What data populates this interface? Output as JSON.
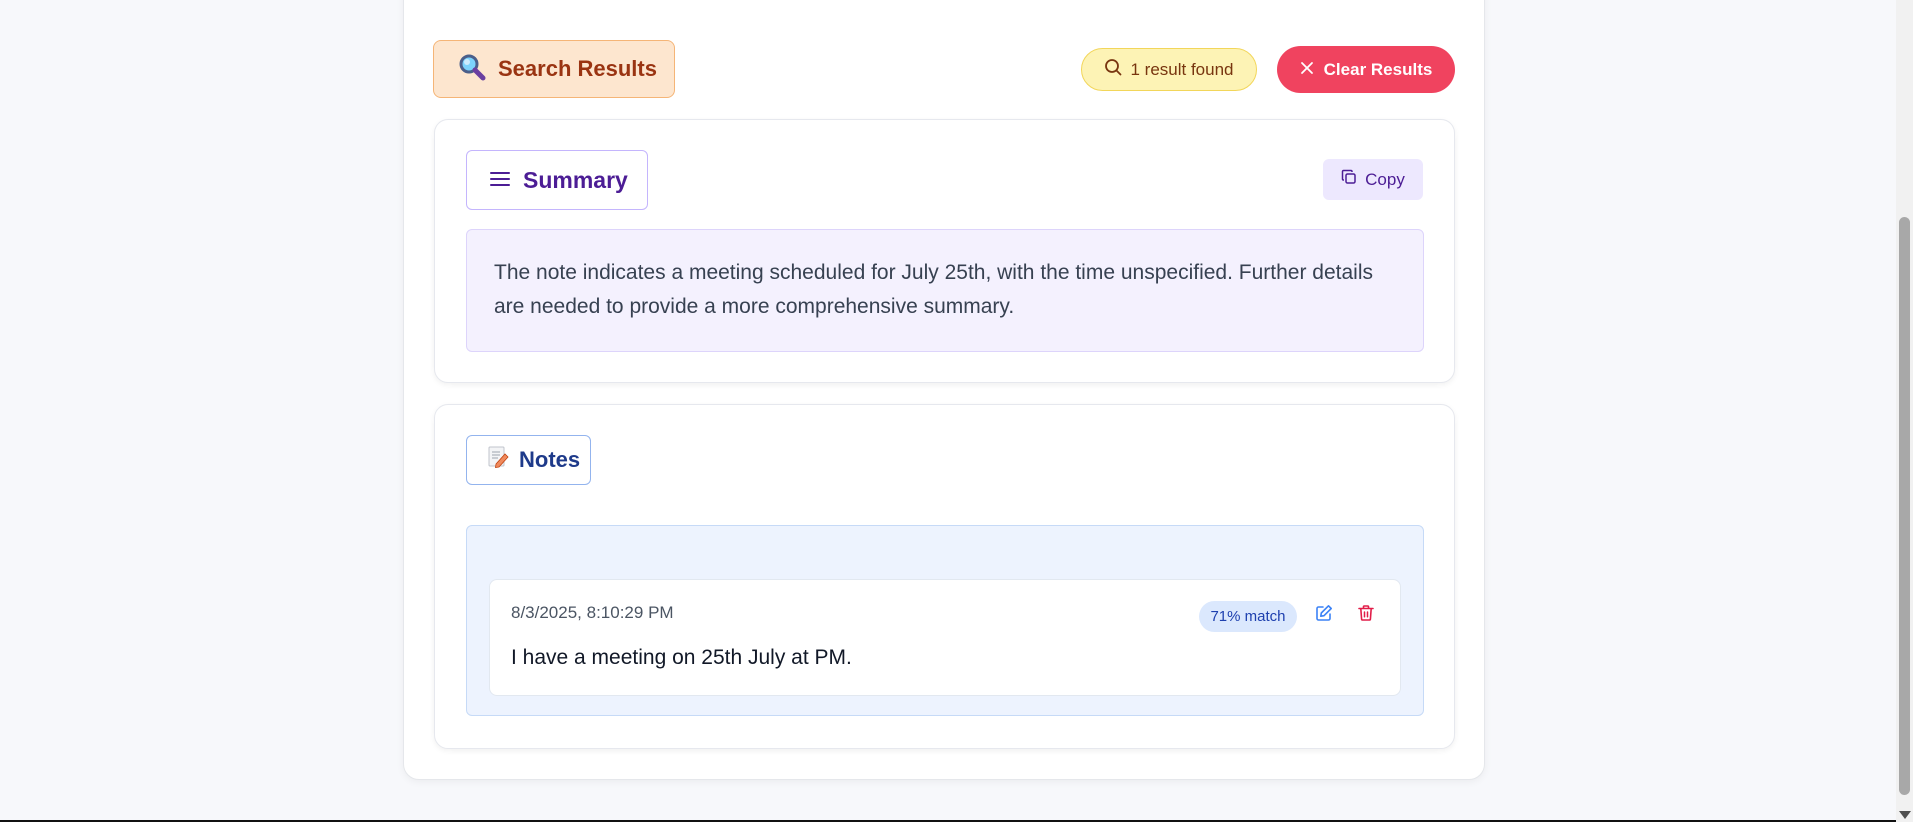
{
  "header": {
    "title": "Search Results",
    "title_icon": "magnifying-glass-emoji",
    "result_count": "1 result found",
    "clear_label": "Clear Results"
  },
  "summary": {
    "tag_label": "Summary",
    "copy_label": "Copy",
    "text": "The note indicates a meeting scheduled for July 25th, with the time unspecified. Further details are needed to provide a more comprehensive summary."
  },
  "notes": {
    "tag_label": "Notes",
    "tag_icon": "memo-emoji",
    "items": [
      {
        "date": "8/3/2025, 8:10:29 PM",
        "match": "71% match",
        "text": "I have a meeting on 25th July at PM."
      }
    ]
  },
  "colors": {
    "clear_button": "#f0435f",
    "summary_accent": "#4c1d95",
    "notes_accent": "#1e3a8a",
    "edit_icon": "#3b82f6",
    "delete_icon": "#e11d48"
  }
}
